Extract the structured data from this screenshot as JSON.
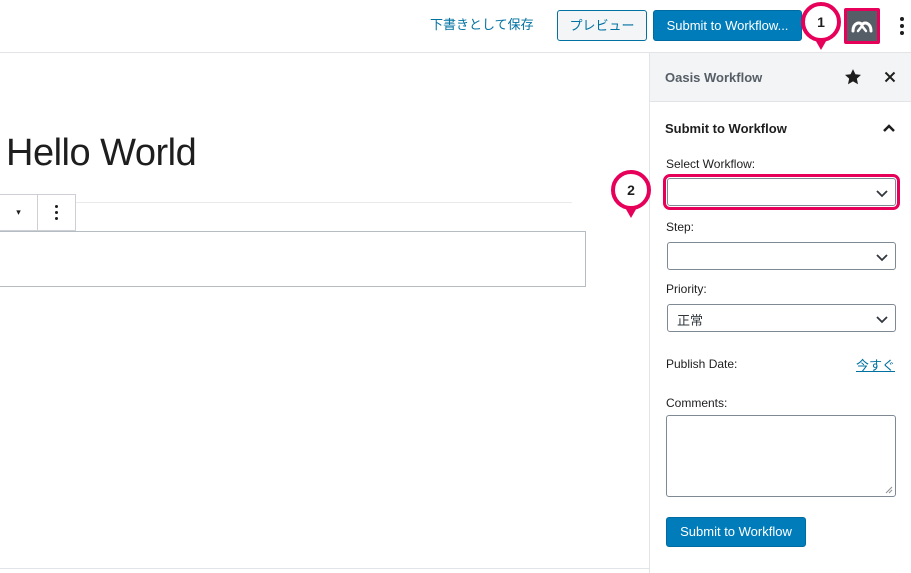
{
  "topbar": {
    "save_draft_label": "下書きとして保存",
    "preview_label": "プレビュー",
    "submit_label": "Submit to Workflow...",
    "oasis_icon": "oasis-workflow-icon",
    "more_icon": "vertical-ellipsis-icon"
  },
  "editor": {
    "post_title": "Hello World",
    "block_toolbar": {
      "caret_icon": "caret-down-icon",
      "more_icon": "vertical-ellipsis-icon"
    }
  },
  "sidebar": {
    "title": "Oasis Workflow",
    "star_icon": "star-icon",
    "close_icon": "close-icon",
    "panel": {
      "title": "Submit to Workflow",
      "expanded": true,
      "select_workflow_label": "Select Workflow:",
      "select_workflow_value": "",
      "step_label": "Step:",
      "step_value": "",
      "priority_label": "Priority:",
      "priority_value": "正常",
      "publish_date_label": "Publish Date:",
      "publish_date_value": "今すぐ",
      "comments_label": "Comments:",
      "comments_value": "",
      "submit_label": "Submit to Workflow"
    }
  },
  "annotations": {
    "marker_1": "1",
    "marker_2": "2",
    "highlight_color": "#e6005a"
  },
  "colors": {
    "primary": "#007cba",
    "link": "#0071a1",
    "sidebar_header_bg": "#f3f4f5"
  }
}
